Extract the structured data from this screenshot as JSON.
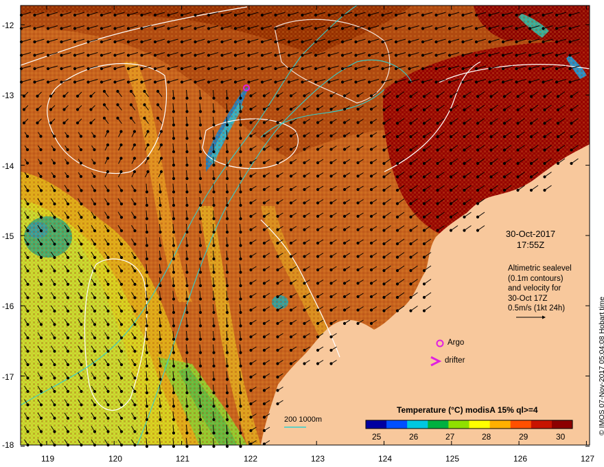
{
  "map": {
    "y_axis_labels": [
      "-12",
      "-13",
      "-14",
      "-15",
      "-16",
      "-17",
      "-18"
    ],
    "x_axis_labels": [
      "119",
      "120",
      "121",
      "122",
      "123",
      "124",
      "125",
      "126",
      "127"
    ],
    "lat_range": [
      -18,
      -11.65
    ],
    "lon_range": [
      118.6,
      127
    ]
  },
  "annotation": {
    "date": "30-Oct-2017",
    "time": "17:55Z",
    "info_lines": [
      "Altimetric sealevel",
      "(0.1m contours)",
      "and velocity for",
      "30-Oct 17Z",
      "0.5m/s (1kt 24h)"
    ]
  },
  "legend": {
    "argo": "Argo",
    "drifter": "drifter",
    "argo_color": "#e020e0",
    "depth_label": "200  1000m",
    "depth_color": "#30d0d0"
  },
  "colorbar": {
    "title": "Temperature  (°C) modisA 15% ql>=4",
    "ticks": [
      "25",
      "26",
      "27",
      "28",
      "29",
      "30"
    ],
    "colors": [
      "#0000a0",
      "#0050ff",
      "#00c8e0",
      "#00b040",
      "#90e000",
      "#ffff00",
      "#ffb000",
      "#ff5000",
      "#c81400",
      "#8c0000"
    ]
  },
  "credit": "© IMOS 07-Nov-2017 05:04:08 Hobart time",
  "colors": {
    "land": "#f8c89c",
    "warm_sst": "#c85a14",
    "hot_sst": "#960000",
    "cool_sst": "#c8e030"
  }
}
